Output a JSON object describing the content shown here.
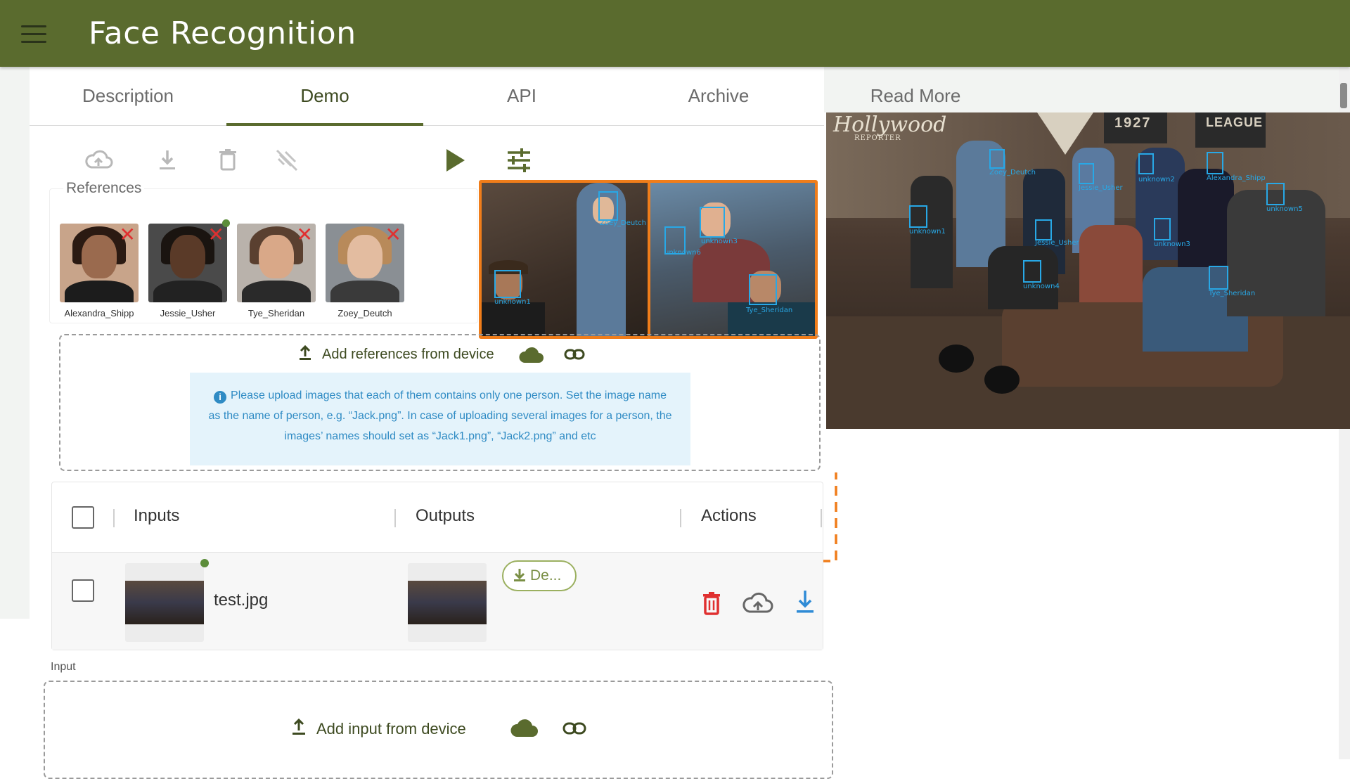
{
  "header": {
    "title": "Face Recognition",
    "menu_icon": "hamburger-menu-icon"
  },
  "tabs": [
    {
      "label": "Description",
      "active": false
    },
    {
      "label": "Demo",
      "active": true
    },
    {
      "label": "API",
      "active": false
    },
    {
      "label": "Archive",
      "active": false
    },
    {
      "label": "Read More",
      "active": false
    }
  ],
  "toolbar": {
    "icons": [
      "cloud-upload-icon",
      "download-icon",
      "trash-icon",
      "no-link-icon",
      "play-icon",
      "settings-sliders-icon"
    ]
  },
  "references": {
    "label": "References",
    "items": [
      {
        "name": "Alexandra_Shipp",
        "state": "remove"
      },
      {
        "name": "Jessie_Usher",
        "state": "selected"
      },
      {
        "name": "Tye_Sheridan",
        "state": "remove"
      },
      {
        "name": "Zoey_Deutch",
        "state": "remove"
      }
    ],
    "add_label": "Add references from device",
    "info_text": "Please upload images that each of them contains only one person. Set the image name as the name of person, e.g. “Jack.png”. In case of uploading several images for a person, the images’ names should set as “Jack1.png”, “Jack2.png” and etc"
  },
  "preview_crops": {
    "left": {
      "labels": [
        "Zoey_Deutch",
        "unknown1"
      ]
    },
    "right": {
      "labels": [
        "unknown3",
        "unknown6",
        "Tye_Sheridan"
      ]
    }
  },
  "table": {
    "headers": {
      "inputs": "Inputs",
      "outputs": "Outputs",
      "actions": "Actions"
    },
    "rows": [
      {
        "input_name": "test.jpg",
        "output_button": "De...",
        "actions": [
          "delete-icon",
          "cloud-upload-icon",
          "download-icon"
        ]
      }
    ]
  },
  "input_section": {
    "label": "Input",
    "add_label": "Add input from device"
  },
  "result_image": {
    "logo_text": "Hollywood",
    "logo_sub": "REPORTER",
    "banner_text": "LEAGUE",
    "year_text": "1927",
    "detections": [
      "Zoey_Deutch",
      "Jessie_Usher",
      "unknown2",
      "Alexandra_Shipp",
      "unknown5",
      "unknown1",
      "Jessie_Usher",
      "unknown3",
      "unknown4",
      "Tye_Sheridan"
    ]
  },
  "colors": {
    "brand": "#5a6b2e",
    "accent_orange": "#f07d1a",
    "detect_blue": "#28a8e6",
    "danger": "#e03030",
    "info_bg": "#e4f3fb"
  }
}
